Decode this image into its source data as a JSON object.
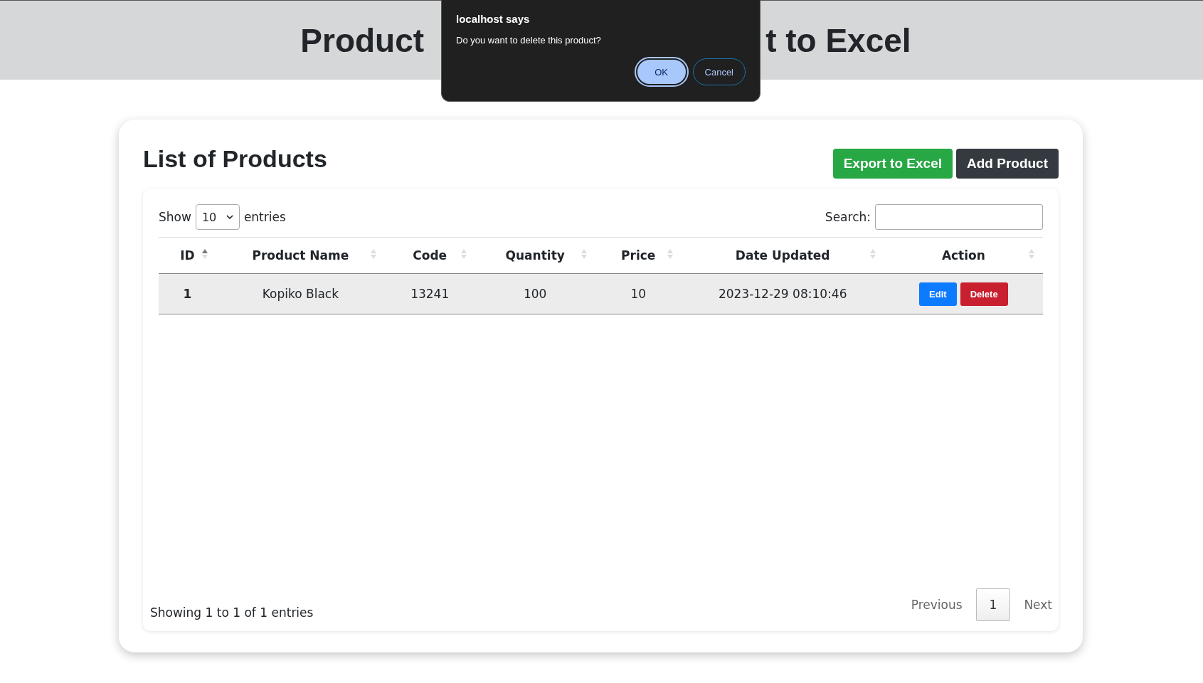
{
  "header": {
    "title_start": "Product",
    "title_end": "t to Excel"
  },
  "dialog": {
    "title": "localhost says",
    "message": "Do you want to delete this product?",
    "buttons": [
      {
        "label": "OK",
        "kind": "primary"
      },
      {
        "label": "Cancel",
        "kind": "secondary"
      }
    ]
  },
  "card": {
    "title": "List of Products",
    "buttons": [
      {
        "label": "Export to Excel",
        "kind": "success"
      },
      {
        "label": "Add Product",
        "kind": "dark"
      }
    ]
  },
  "table_controls": {
    "show_label": "Show",
    "page_size": "10",
    "entries_label": "entries",
    "search_label": "Search:"
  },
  "table": {
    "columns": [
      {
        "label": "ID",
        "sorted": true
      },
      {
        "label": "Product Name",
        "sorted": false
      },
      {
        "label": "Code",
        "sorted": false
      },
      {
        "label": "Quantity",
        "sorted": false
      },
      {
        "label": "Price",
        "sorted": false
      },
      {
        "label": "Date Updated",
        "sorted": false
      },
      {
        "label": "Action",
        "sorted": false
      }
    ],
    "rows": [
      {
        "cells": [
          "1",
          "Kopiko Black",
          "13241",
          "100",
          "10",
          "2023-12-29 08:10:46"
        ],
        "actions": [
          {
            "label": "Edit",
            "kind": "primary"
          },
          {
            "label": "Delete",
            "kind": "danger"
          }
        ]
      }
    ]
  },
  "footer": {
    "info": "Showing 1 to 1 of 1 entries",
    "pagination": [
      {
        "label": "Previous",
        "kind": "nav",
        "selected": false
      },
      {
        "label": "1",
        "kind": "page",
        "selected": true
      },
      {
        "label": "Next",
        "kind": "nav",
        "selected": false
      }
    ]
  }
}
